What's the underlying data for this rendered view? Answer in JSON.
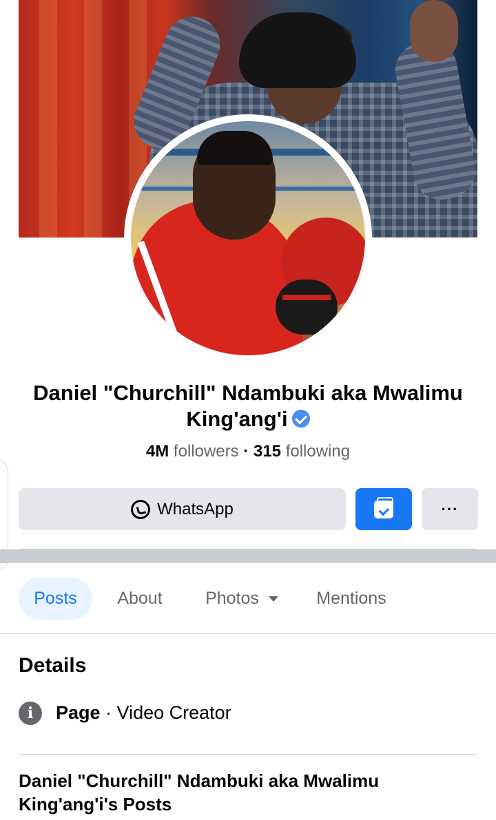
{
  "profile": {
    "name": "Daniel \"Churchill\" Ndambuki aka Mwalimu King'ang'i",
    "followers_count": "4M",
    "followers_label": "followers",
    "separator": "·",
    "following_count": "315",
    "following_label": "following",
    "verified": true
  },
  "actions": {
    "whatsapp_label": "WhatsApp",
    "shop_icon": "shop-icon",
    "more_label": "···"
  },
  "tabs": [
    {
      "label": "Posts",
      "active": true
    },
    {
      "label": "About",
      "active": false
    },
    {
      "label": "Photos",
      "active": false
    },
    {
      "label": "Mentions",
      "active": false
    }
  ],
  "details": {
    "title": "Details",
    "page_label": "Page",
    "separator": " · ",
    "category": "Video Creator",
    "icon": "info-icon"
  },
  "posts_section": {
    "heading": "Daniel \"Churchill\" Ndambuki aka Mwalimu King'ang'i's Posts"
  },
  "colors": {
    "accent": "#1877f2",
    "active_tab_bg": "#e7f3ff",
    "button_grey": "#e4e6eb",
    "verified_blue": "#4b8cf5"
  }
}
